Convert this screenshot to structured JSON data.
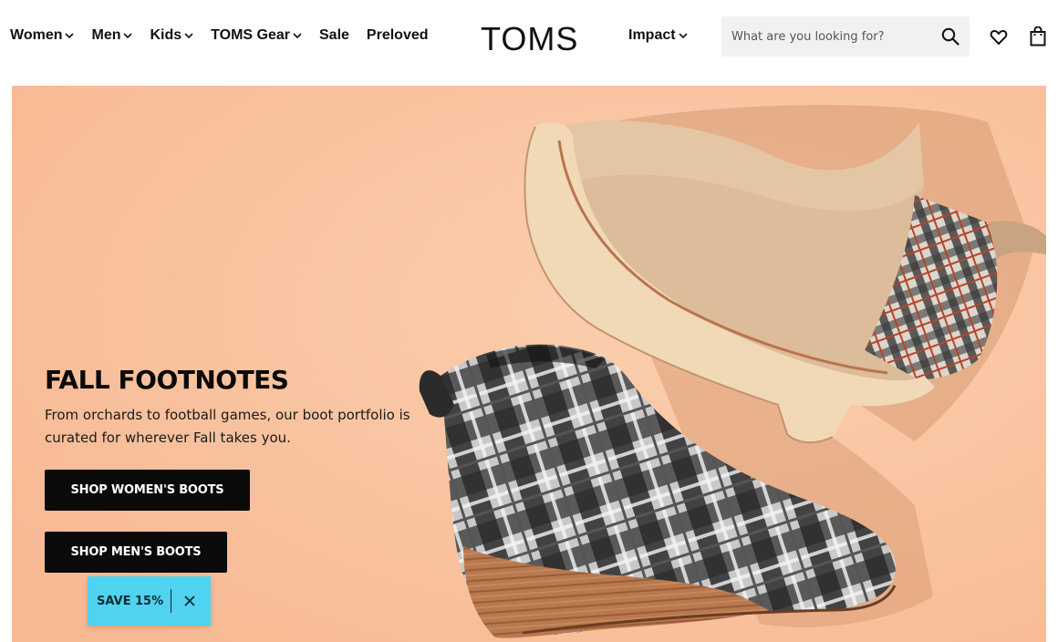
{
  "nav": {
    "items": [
      {
        "label": "Women",
        "has_dropdown": true
      },
      {
        "label": "Men",
        "has_dropdown": true
      },
      {
        "label": "Kids",
        "has_dropdown": true
      },
      {
        "label": "TOMS Gear",
        "has_dropdown": true
      },
      {
        "label": "Sale",
        "has_dropdown": false
      },
      {
        "label": "Preloved",
        "has_dropdown": false
      }
    ],
    "impact": {
      "label": "Impact",
      "has_dropdown": true
    }
  },
  "logo": {
    "text": "TOMS"
  },
  "search": {
    "placeholder": "What are you looking for?",
    "icon": "search-icon"
  },
  "icons": {
    "wishlist": "heart-icon",
    "cart": "shopping-bag-icon"
  },
  "hero": {
    "title": "FALL FOOTNOTES",
    "subtitle": "From orchards to football games, our boot portfolio is curated for wherever Fall takes you.",
    "buttons": {
      "women": "SHOP WOMEN'S BOOTS",
      "men": "SHOP MEN'S BOOTS"
    },
    "background_color": "#fac3a0"
  },
  "promo": {
    "label": "SAVE 15%",
    "close_icon": "close-icon",
    "color": "#4fd3f0"
  }
}
